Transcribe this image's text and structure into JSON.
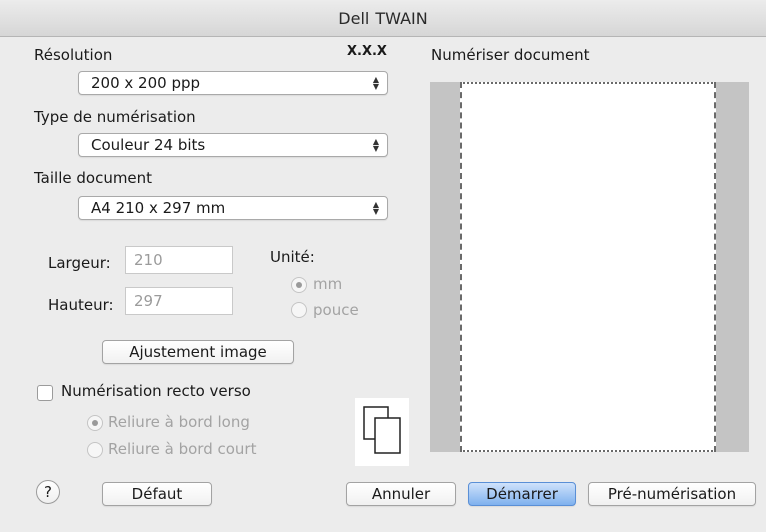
{
  "window": {
    "title_part1": "Dell",
    "title_part2": "TWAIN"
  },
  "version": "X.X.X",
  "resolution": {
    "label": "Résolution",
    "value": "200 x 200 ppp"
  },
  "scan_type": {
    "label": "Type de numérisation",
    "value": "Couleur 24 bits"
  },
  "doc_size": {
    "label": "Taille document",
    "value": "A4  210 x 297 mm"
  },
  "width": {
    "label": "Largeur:",
    "value": "210"
  },
  "height": {
    "label": "Hauteur:",
    "value": "297"
  },
  "unit": {
    "label": "Unité:",
    "options": [
      "mm",
      "pouce"
    ],
    "selected": "mm"
  },
  "adjust_button": "Ajustement image",
  "duplex": {
    "label": "Numérisation recto verso",
    "checked": false,
    "options": [
      "Reliure à bord long",
      "Reliure à bord court"
    ],
    "selected": "Reliure à bord long"
  },
  "preview": {
    "label": "Numériser document"
  },
  "buttons": {
    "help": "?",
    "default": "Défaut",
    "cancel": "Annuler",
    "start": "Démarrer",
    "prescan": "Pré-numérisation"
  },
  "colors": {
    "primary_button": "#7fb1ee",
    "preview_bg": "#c4c4c4"
  }
}
